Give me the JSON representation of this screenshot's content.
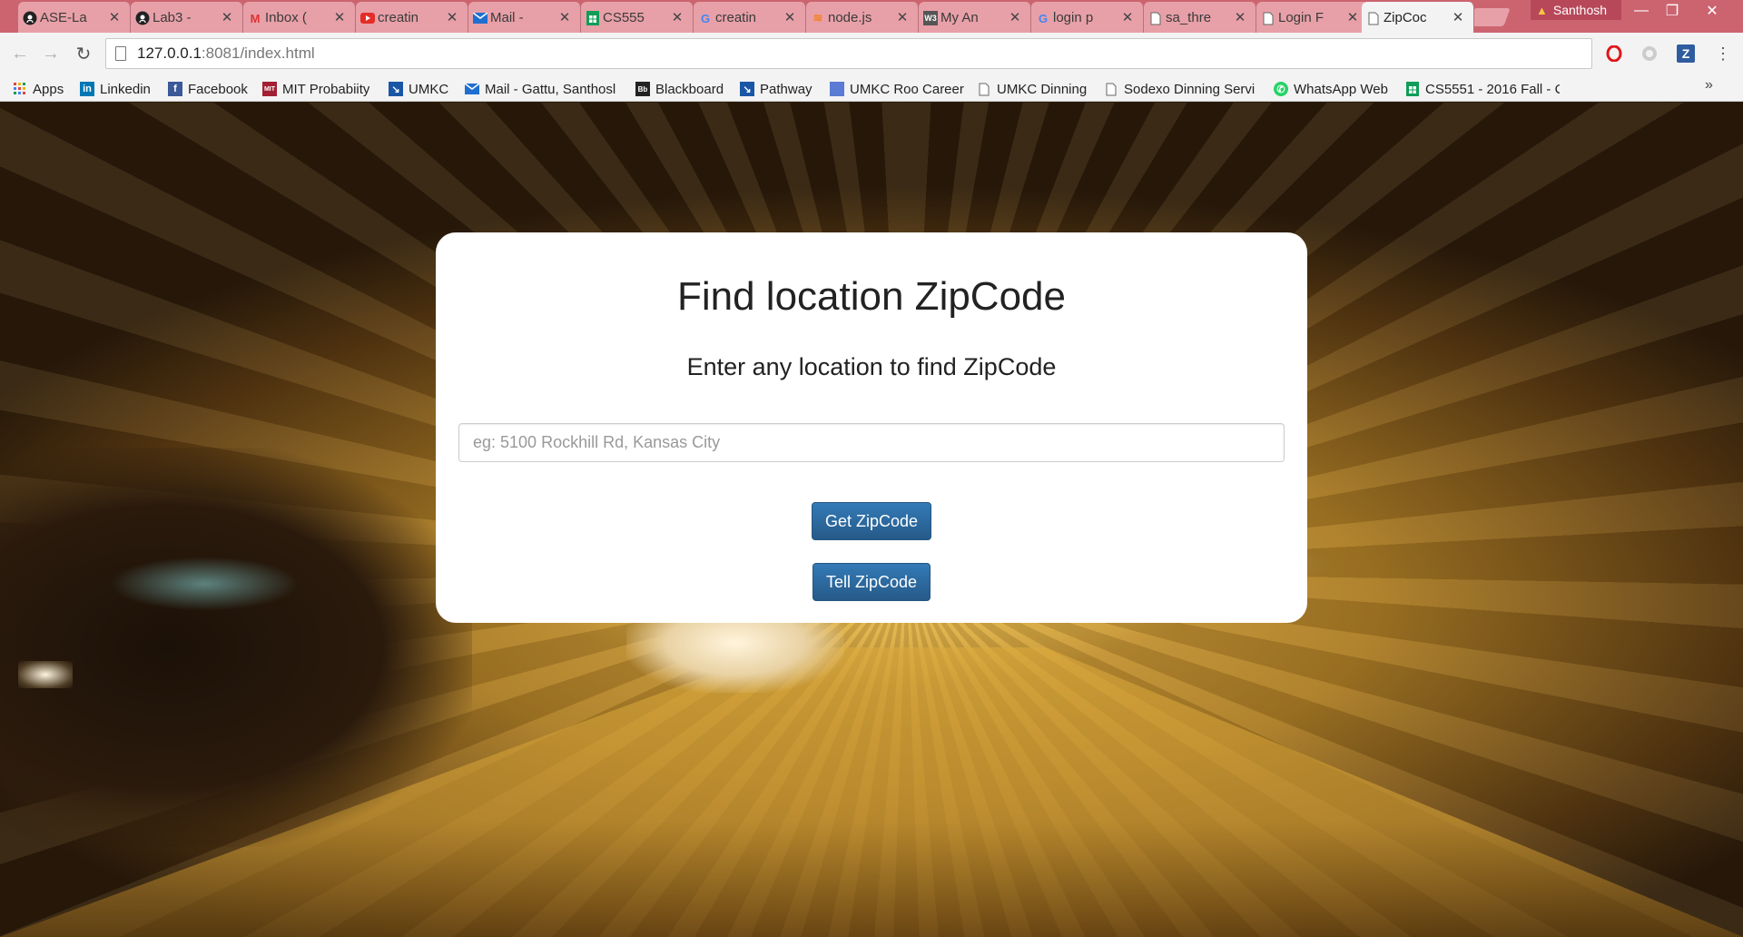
{
  "tabs": [
    {
      "title": "ASE-La",
      "icon": "github-icon"
    },
    {
      "title": "Lab3 - ",
      "icon": "github-icon"
    },
    {
      "title": "Inbox (",
      "icon": "gmail-icon"
    },
    {
      "title": "creatin",
      "icon": "youtube-icon"
    },
    {
      "title": "Mail - ",
      "icon": "mail-icon"
    },
    {
      "title": "CS555",
      "icon": "sheets-icon"
    },
    {
      "title": "creatin",
      "icon": "google-icon"
    },
    {
      "title": "node.js",
      "icon": "stack-icon"
    },
    {
      "title": "My An",
      "icon": "w3schools-icon"
    },
    {
      "title": "login p",
      "icon": "google-icon"
    },
    {
      "title": "sa_thre",
      "icon": "page-icon"
    },
    {
      "title": "Login F",
      "icon": "page-icon"
    },
    {
      "title": "ZipCoc",
      "icon": "page-icon",
      "active": true
    }
  ],
  "profile": {
    "name": "Santhosh"
  },
  "address": {
    "host": "127.0.0.1",
    "path": ":8081/index.html"
  },
  "bookmarks": [
    {
      "label": "Apps"
    },
    {
      "label": "Linkedin"
    },
    {
      "label": "Facebook"
    },
    {
      "label": "MIT Probabiity"
    },
    {
      "label": "UMKC"
    },
    {
      "label": "Mail - Gattu, Santhosl"
    },
    {
      "label": "Blackboard"
    },
    {
      "label": "Pathway"
    },
    {
      "label": "UMKC Roo Career"
    },
    {
      "label": "UMKC Dinning"
    },
    {
      "label": "Sodexo Dinning Servi"
    },
    {
      "label": "WhatsApp Web"
    },
    {
      "label": "CS5551 - 2016 Fall - C"
    }
  ],
  "card": {
    "title": "Find location ZipCode",
    "subtitle": "Enter any location to find ZipCode",
    "input_placeholder": "eg: 5100 Rockhill Rd, Kansas City",
    "input_value": "",
    "get_button": "Get ZipCode",
    "tell_button": "Tell ZipCode"
  },
  "colors": {
    "tabstrip": "#cc6470",
    "button": "#337ab7",
    "profile": "#b7485a"
  }
}
